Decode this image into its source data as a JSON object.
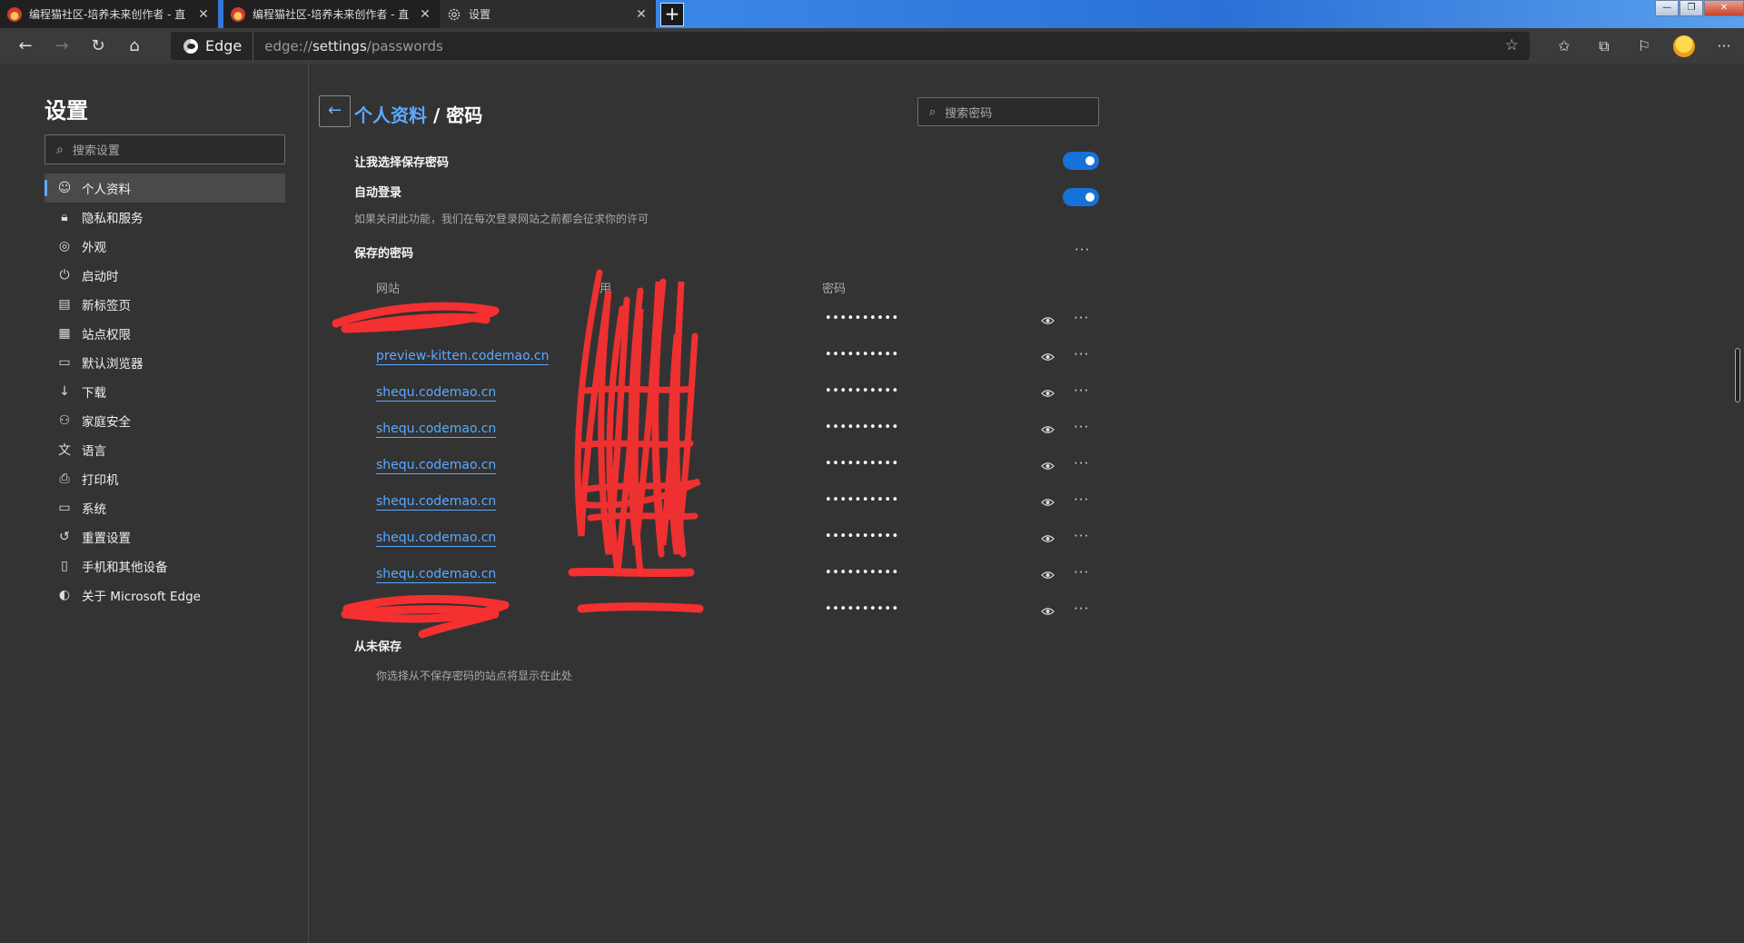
{
  "tabs": [
    {
      "title": "编程猫社区-培养未来创作者 - 直",
      "close": "✕"
    },
    {
      "title": "编程猫社区-培养未来创作者 - 直",
      "close": "✕"
    },
    {
      "title": "设置",
      "close": "✕"
    }
  ],
  "new_tab": "+",
  "window_controls": {
    "minimize": "—",
    "restore": "❐",
    "close": "✕"
  },
  "toolbar": {
    "back": "←",
    "forward": "→",
    "refresh": "↻",
    "home": "⌂",
    "edge_label": "Edge",
    "url_scheme": "edge://",
    "url_path": "settings",
    "url_rest": "/passwords",
    "favorite_star": "☆",
    "favorites": "✩",
    "collections": "⧉",
    "feedback": "⚐",
    "more": "···"
  },
  "sidebar": {
    "title": "设置",
    "search_placeholder": "搜索设置",
    "items": [
      {
        "label": "个人资料",
        "icon": "profile-icon",
        "glyph": "☺"
      },
      {
        "label": "隐私和服务",
        "icon": "lock-icon",
        "glyph": "🔒︎"
      },
      {
        "label": "外观",
        "icon": "palette-icon",
        "glyph": "◎"
      },
      {
        "label": "启动时",
        "icon": "power-icon",
        "glyph": "⏻"
      },
      {
        "label": "新标签页",
        "icon": "newtab-icon",
        "glyph": "▤"
      },
      {
        "label": "站点权限",
        "icon": "site-permissions-icon",
        "glyph": "▦"
      },
      {
        "label": "默认浏览器",
        "icon": "browser-icon",
        "glyph": "▭"
      },
      {
        "label": "下载",
        "icon": "download-icon",
        "glyph": "↓"
      },
      {
        "label": "家庭安全",
        "icon": "family-icon",
        "glyph": "⚇"
      },
      {
        "label": "语言",
        "icon": "language-icon",
        "glyph": "文"
      },
      {
        "label": "打印机",
        "icon": "printer-icon",
        "glyph": "⎙"
      },
      {
        "label": "系统",
        "icon": "system-icon",
        "glyph": "▭"
      },
      {
        "label": "重置设置",
        "icon": "reset-icon",
        "glyph": "↺"
      },
      {
        "label": "手机和其他设备",
        "icon": "phone-icon",
        "glyph": "▯"
      },
      {
        "label": "关于 Microsoft Edge",
        "icon": "edge-icon",
        "glyph": "◐"
      }
    ]
  },
  "main": {
    "back_glyph": "←",
    "breadcrumb_link": "个人资料",
    "breadcrumb_sep": " / ",
    "breadcrumb_current": "密码",
    "search_placeholder": "搜索密码",
    "offer_to_save": {
      "label": "让我选择保存密码",
      "enabled": true
    },
    "auto_signin": {
      "label": "自动登录",
      "enabled": true,
      "description": "如果关闭此功能，我们在每次登录网站之前都会征求你的许可"
    },
    "saved_passwords_title": "保存的密码",
    "more_glyph": "···",
    "columns": {
      "website": "网站",
      "username": "用",
      "password": "密码"
    },
    "password_mask": "••••••••••",
    "rows": [
      {
        "site": ""
      },
      {
        "site": "preview-kitten.codemao.cn"
      },
      {
        "site": "shequ.codemao.cn"
      },
      {
        "site": "shequ.codemao.cn"
      },
      {
        "site": "shequ.codemao.cn"
      },
      {
        "site": "shequ.codemao.cn"
      },
      {
        "site": "shequ.codemao.cn"
      },
      {
        "site": "shequ.codemao.cn"
      },
      {
        "site": ""
      }
    ],
    "never_saved_title": "从未保存",
    "never_saved_desc": "你选择从不保存密码的站点将显示在此处"
  },
  "colors": {
    "accent": "#5aa9ff",
    "toggle_on": "#1672d8",
    "redaction": "#ff3030",
    "background": "#333334"
  }
}
